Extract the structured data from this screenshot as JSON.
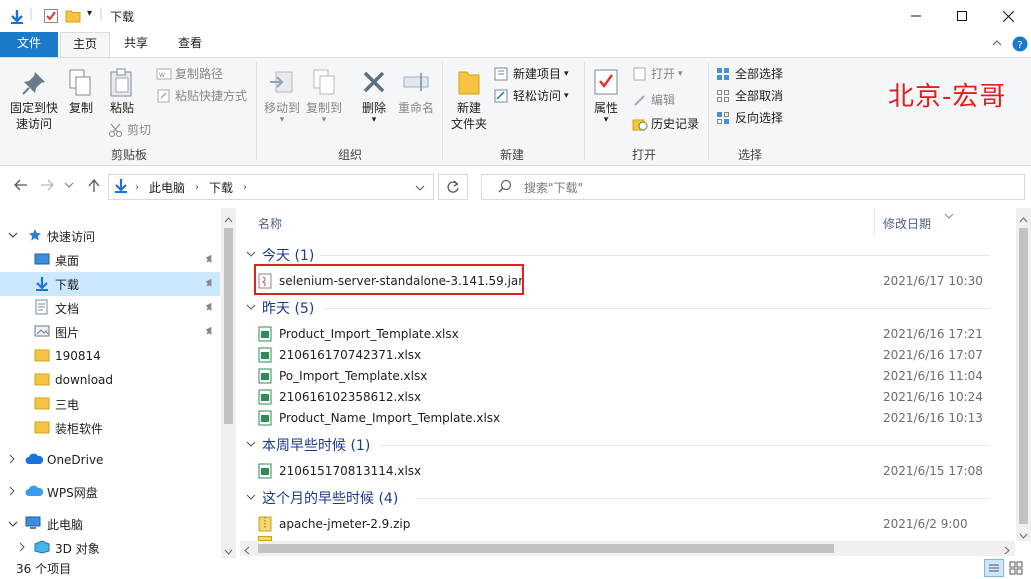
{
  "window": {
    "title": "下载",
    "minimize": "—",
    "maximize": "☐",
    "close": "✕"
  },
  "ribbon_tabs": [
    "文件",
    "主页",
    "共享",
    "查看"
  ],
  "ribbon": {
    "clipboard": {
      "pin": "固定到快\n速访问",
      "copy": "复制",
      "paste": "粘贴",
      "copy_path": "复制路径",
      "paste_shortcut": "粘贴快捷方式",
      "cut": "剪切",
      "label": "剪贴板"
    },
    "organize": {
      "move_to": "移动到",
      "copy_to": "复制到",
      "delete": "删除",
      "rename": "重命名",
      "label": "组织"
    },
    "new": {
      "new_folder": "新建\n文件夹",
      "new_item": "新建项目",
      "easy_access": "轻松访问",
      "label": "新建"
    },
    "open": {
      "properties": "属性",
      "open": "打开",
      "edit": "编辑",
      "history": "历史记录",
      "label": "打开"
    },
    "select": {
      "select_all": "全部选择",
      "select_none": "全部取消",
      "invert": "反向选择",
      "label": "选择"
    },
    "watermark": "北京-宏哥"
  },
  "address": {
    "segments": [
      "此电脑",
      "下载"
    ],
    "search_placeholder": "搜索\"下载\""
  },
  "nav": {
    "quick_access": "快速访问",
    "items": [
      "桌面",
      "下载",
      "文档",
      "图片",
      "190814",
      "download",
      "三电",
      "装柜软件"
    ],
    "onedrive": "OneDrive",
    "wps": "WPS网盘",
    "this_pc": "此电脑",
    "objects3d": "3D 对象"
  },
  "columns": {
    "name": "名称",
    "date": "修改日期"
  },
  "groups": [
    {
      "title": "今天 (1)",
      "files": [
        {
          "name": "selenium-server-standalone-3.141.59.jar",
          "date": "2021/6/17 10:30",
          "type": "jar"
        }
      ]
    },
    {
      "title": "昨天 (5)",
      "files": [
        {
          "name": "Product_Import_Template.xlsx",
          "date": "2021/6/16 17:21",
          "type": "xlsx"
        },
        {
          "name": "210616170742371.xlsx",
          "date": "2021/6/16 17:07",
          "type": "xlsx"
        },
        {
          "name": "Po_Import_Template.xlsx",
          "date": "2021/6/16 11:04",
          "type": "xlsx"
        },
        {
          "name": "210616102358612.xlsx",
          "date": "2021/6/16 10:24",
          "type": "xlsx"
        },
        {
          "name": "Product_Name_Import_Template.xlsx",
          "date": "2021/6/16 10:13",
          "type": "xlsx"
        }
      ]
    },
    {
      "title": "本周早些时候 (1)",
      "files": [
        {
          "name": "210615170813114.xlsx",
          "date": "2021/6/15 17:08",
          "type": "xlsx"
        }
      ]
    },
    {
      "title": "这个月的早些时候 (4)",
      "files": [
        {
          "name": "apache-jmeter-2.9.zip",
          "date": "2021/6/2 9:00",
          "type": "zip"
        }
      ]
    }
  ],
  "status": {
    "count": "36 个项目"
  }
}
